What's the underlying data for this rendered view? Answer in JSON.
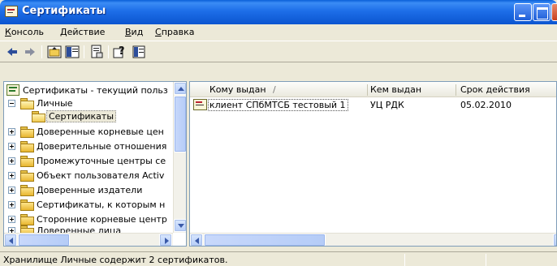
{
  "window": {
    "title": "Сертификаты"
  },
  "menu": {
    "items": [
      {
        "accel": "К",
        "rest": "онсоль"
      },
      {
        "accel": "Д",
        "rest": "ействие"
      },
      {
        "accel": "В",
        "rest": "ид"
      },
      {
        "accel": "С",
        "rest": "правка"
      }
    ]
  },
  "toolbar": {
    "buttons": [
      "back-icon",
      "forward-icon",
      "up-folder-icon",
      "show-hide-tree-icon",
      "export-list-icon",
      "help-icon",
      "console-window-icon"
    ]
  },
  "tree": {
    "root": "Сертификаты - текущий польз",
    "items": [
      "Личные",
      "Сертификаты",
      "Доверенные корневые цен",
      "Доверительные отношения",
      "Промежуточные центры се",
      "Объект пользователя Activ",
      "Доверенные издатели",
      "Сертификаты, к которым н",
      "Сторонние корневые центр",
      "Доверенные лица"
    ]
  },
  "list": {
    "columns": [
      "Кому выдан",
      "/",
      "Кем выдан",
      "Срок действия"
    ],
    "rows": [
      {
        "issued_to": "клиент СПбМТСБ тестовый 1",
        "issued_by": "УЦ РДК",
        "expires": "05.02.2010"
      }
    ]
  },
  "status": {
    "text": "Хранилище Личные содержит 2 сертификатов."
  },
  "colors": {
    "titlebar": "#0b55d0",
    "chrome": "#ece9d8",
    "border": "#7f9db9"
  }
}
